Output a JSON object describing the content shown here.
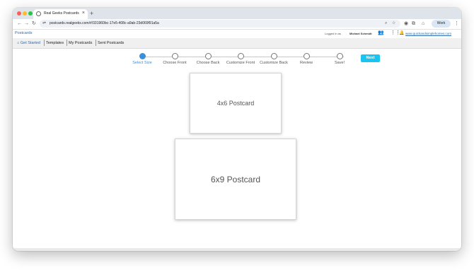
{
  "browser": {
    "tab_title": "Real Geeks Postcards",
    "url": "postcards.realgeeks.com/#/331960bc-17e5-408c-a9ab-23d069f91a5a",
    "profile_label": "Work"
  },
  "header": {
    "logo_label": "Postcards",
    "logged_in_as": "Logged in as",
    "user_name": "Michael Schmidt",
    "site_link": "www.quickandsimplehomes.com"
  },
  "nav": {
    "items": [
      "Get Started",
      "Templates",
      "My Postcards",
      "Sent Postcards"
    ]
  },
  "stepper": {
    "steps": [
      "Select Size",
      "Choose Front",
      "Choose Back",
      "Customize Front",
      "Customize Back",
      "Review",
      "Save!"
    ],
    "active_index": 0
  },
  "next_label": "Next",
  "options": {
    "small": "4x6 Postcard",
    "large": "6x9 Postcard"
  },
  "colors": {
    "accent": "#3a8fd9",
    "next_button": "#19c4f0",
    "link": "#2a6db5"
  }
}
